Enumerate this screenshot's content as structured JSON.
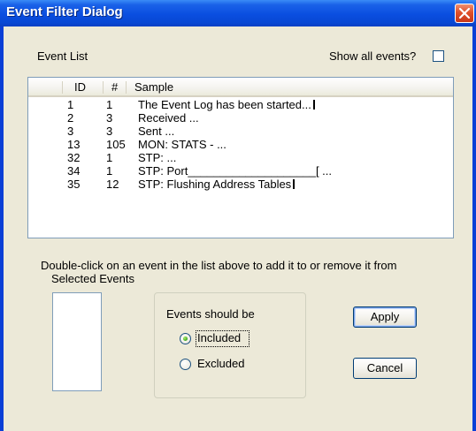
{
  "window": {
    "title": "Event Filter Dialog"
  },
  "event_list": {
    "label": "Event List",
    "show_all_label": "Show all events?",
    "show_all_checked": false,
    "columns": [
      "ID",
      "#",
      "Sample"
    ],
    "rows": [
      {
        "id": "1",
        "count": "1",
        "sample": "The Event Log has been started..."
      },
      {
        "id": "2",
        "count": "3",
        "sample": "Received  ..."
      },
      {
        "id": "3",
        "count": "3",
        "sample": "Sent  ..."
      },
      {
        "id": "13",
        "count": "105",
        "sample": "MON: STATS - ..."
      },
      {
        "id": "32",
        "count": "1",
        "sample": "STP:  ..."
      },
      {
        "id": "34",
        "count": "1",
        "sample": "STP: Port____________________[ ..."
      },
      {
        "id": "35",
        "count": "12",
        "sample": "STP: Flushing Address Tables"
      }
    ]
  },
  "hint_text": "Double-click on an event in the list above to add it to or remove it from",
  "selected_events": {
    "label": "Selected Events"
  },
  "filter_mode": {
    "label": "Events should be",
    "included_label": "Included",
    "excluded_label": "Excluded",
    "selected": "Included"
  },
  "buttons": {
    "apply": "Apply",
    "cancel": "Cancel"
  },
  "colors": {
    "title_bar": "#0a4ee0",
    "dialog_bg": "#ece9d8",
    "close_button": "#e0502a",
    "radio_selected": "#38a820"
  }
}
